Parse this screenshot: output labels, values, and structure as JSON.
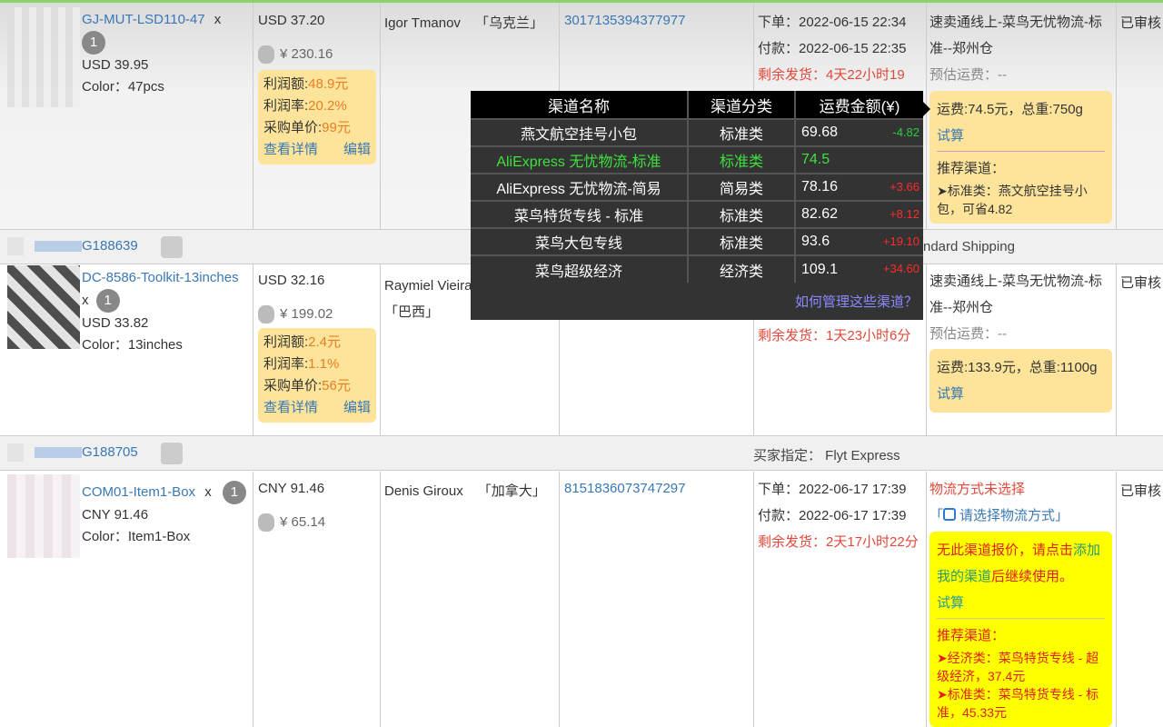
{
  "orders": [
    {
      "sku": "GJ-MUT-LSD110-47",
      "qty_prefix": "x",
      "qty": "1",
      "item_price": "USD 39.95",
      "variant": "Color：47pcs",
      "total": "USD 37.20",
      "cny": "¥ 230.16",
      "profit_amount_label": "利润额:",
      "profit_amount": "48.9元",
      "profit_rate_label": "利润率:",
      "profit_rate": "20.2%",
      "unit_cost_label": "采购单价:",
      "unit_cost": "99元",
      "view_details": "查看详情",
      "edit": "编辑",
      "buyer": "Igor Tmanov",
      "country": "「乌克兰」",
      "tracking": "3017135394377977",
      "order_time": "下单：2022-06-15 22:34",
      "pay_time": "付款：2022-06-15 22:35",
      "remaining_label": "剩余发货：",
      "remaining": "4天22小时19",
      "shipping_method": "速卖通线上-菜鸟无忧物流-标准--郑州仓",
      "estimated": "预估运费：--",
      "freight": "运费:74.5元，总重:750g",
      "calc": "试算",
      "rec_title": "推荐渠道：",
      "rec": [
        "➤标准类：燕文航空挂号小包，可省4.82"
      ],
      "status": "已审核"
    },
    {
      "order_no": "G188639",
      "buyer_specified": "ndard Shipping",
      "sku": "DC-8586-Toolkit-13inches",
      "qty_prefix": "x",
      "qty": "1",
      "item_price": "USD 33.82",
      "variant": "Color：13inches",
      "total": "USD 32.16",
      "cny": "¥ 199.02",
      "profit_amount_label": "利润额:",
      "profit_amount": "2.4元",
      "profit_rate_label": "利润率:",
      "profit_rate": "1.1%",
      "unit_cost_label": "采购单价:",
      "unit_cost": "56元",
      "view_details": "查看详情",
      "edit": "编辑",
      "buyer": "Raymiel Vieira",
      "country": "「巴西」",
      "remaining_label": "剩余发货：",
      "remaining": "1天23小时6分",
      "shipping_method": "速卖通线上-菜鸟无忧物流-标准--郑州仓",
      "estimated": "预估运费：--",
      "freight": "运费:133.9元，总重:1100g",
      "calc": "试算",
      "status": "已审核"
    },
    {
      "order_no": "G188705",
      "buyer_specified": "买家指定： Flyt Express",
      "sku": "COM01-Item1-Box",
      "qty_prefix": "x",
      "qty": "1",
      "item_price": "CNY 91.46",
      "variant": "Color：Item1-Box",
      "total": "CNY 91.46",
      "cny": "¥ 65.14",
      "buyer": "Denis Giroux",
      "country": "「加拿大」",
      "tracking": "8151836073747297",
      "order_time": "下单：2022-06-17 17:39",
      "pay_time": "付款：2022-06-17 17:39",
      "remaining_label": "剩余发货：",
      "remaining": "2天17小时22分",
      "shipping_unselected": "物流方式未选择",
      "select_shipping": "请选择物流方式",
      "no_quote_1": "无此渠道报价，请点击",
      "no_quote_link": "添加我的渠道",
      "no_quote_2": "后继续使用。",
      "calc": "试算",
      "rec_title": "推荐渠道：",
      "rec": [
        "➤经济类：菜鸟特货专线 - 超级经济，37.4元",
        "➤标准类：菜鸟特货专线 - 标准，45.33元"
      ],
      "status": "已审核"
    }
  ],
  "popup": {
    "headers": [
      "渠道名称",
      "渠道分类",
      "运费金额(¥)"
    ],
    "rows": [
      {
        "name": "燕文航空挂号小包",
        "type": "标准类",
        "amount": "69.68",
        "diff": "-4.82",
        "diff_color": "#2ecc40"
      },
      {
        "name": "AliExpress 无忧物流-标准",
        "type": "标准类",
        "amount": "74.5",
        "diff": "",
        "selected": true
      },
      {
        "name": "AliExpress 无忧物流-简易",
        "type": "简易类",
        "amount": "78.16",
        "diff": "+3.66",
        "diff_color": "#ff2a2a"
      },
      {
        "name": "菜鸟特货专线 - 标准",
        "type": "标准类",
        "amount": "82.62",
        "diff": "+8.12",
        "diff_color": "#ff2a2a"
      },
      {
        "name": "菜鸟大包专线",
        "type": "标准类",
        "amount": "93.6",
        "diff": "+19.10",
        "diff_color": "#ff2a2a"
      },
      {
        "name": "菜鸟超级经济",
        "type": "经济类",
        "amount": "109.1",
        "diff": "+34.60",
        "diff_color": "#ff2a2a"
      }
    ],
    "footer_link": "如何管理这些渠道？"
  }
}
